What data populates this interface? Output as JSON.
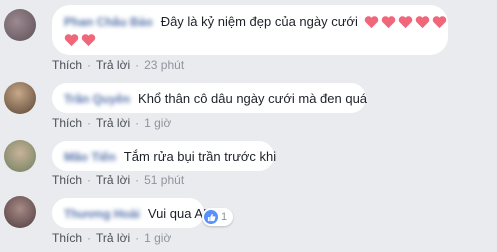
{
  "comments": [
    {
      "name": "Phan Châu Bảo",
      "text": "Đây là kỷ niệm đẹp của ngày cưới",
      "actions": {
        "like": "Thích",
        "reply": "Trả lời",
        "time": "23 phút"
      }
    },
    {
      "name": "Trần Quyên",
      "text": "Khổ thân cô dâu ngày cưới mà đen quá",
      "actions": {
        "like": "Thích",
        "reply": "Trả lời",
        "time": "1 giờ"
      }
    },
    {
      "name": "Mão Tiến",
      "text": "Tắm rửa bụi trần trước khi",
      "actions": {
        "like": "Thích",
        "reply": "Trả lời",
        "time": "51 phút"
      }
    },
    {
      "name": "Thương Hoài",
      "text": "Vui qua AK",
      "reaction_count": "1",
      "actions": {
        "like": "Thích",
        "reply": "Trả lời",
        "time": "1 giờ"
      }
    }
  ],
  "colors": {
    "background": "#e9ebee",
    "bubble": "#ffffff",
    "name": "#365899",
    "heart": "#f0667a",
    "like_blue": "#5890ff"
  },
  "icons": [
    "heart-icon",
    "like-reaction-icon"
  ]
}
